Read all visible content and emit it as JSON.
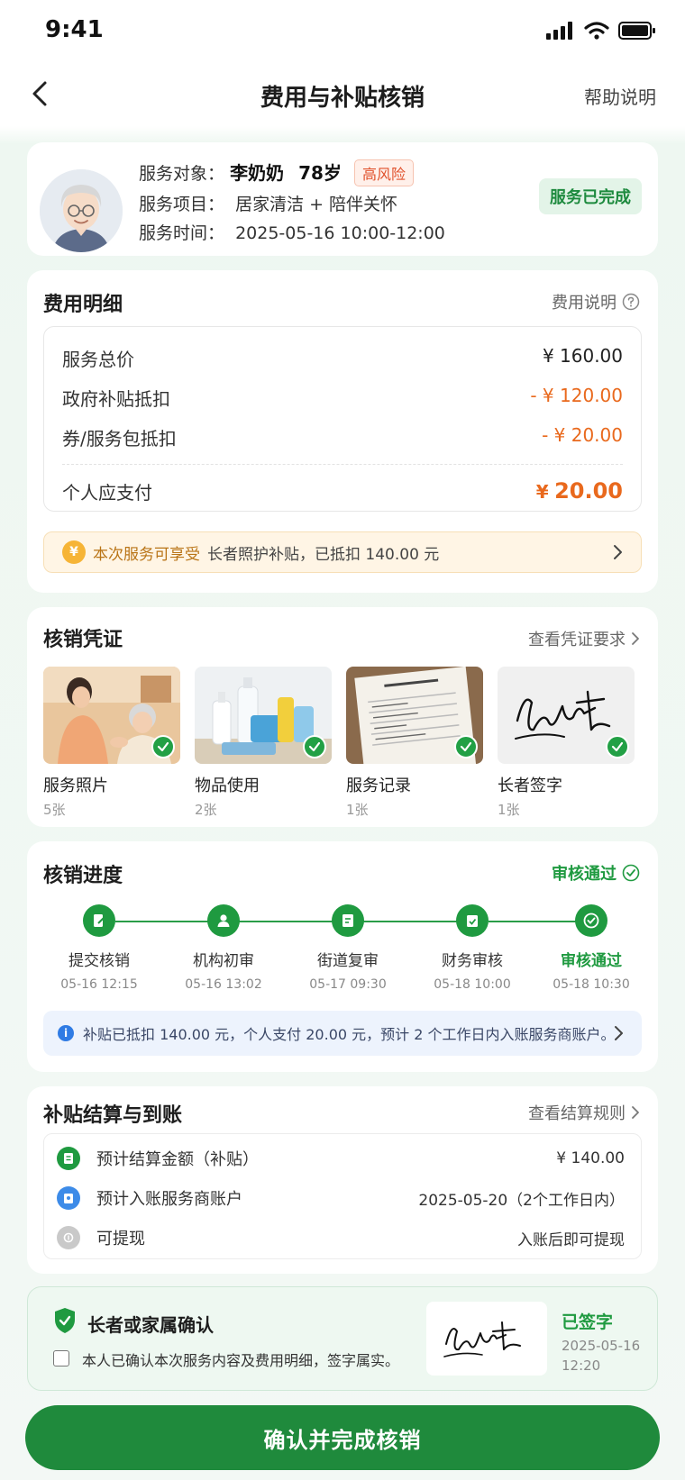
{
  "status_bar": {
    "time": "9:41"
  },
  "nav": {
    "title": "费用与补贴核销",
    "help": "帮助说明"
  },
  "service": {
    "target_label": "服务对象：",
    "name": "李奶奶",
    "age": "78岁",
    "risk": "高风险",
    "item_label": "服务项目：",
    "item": "居家清洁 + 陪伴关怀",
    "time_label": "服务时间：",
    "time": "2025-05-16  10:00-12:00",
    "status": "服务已完成"
  },
  "fees": {
    "title": "费用明细",
    "explain": "费用说明",
    "rows": [
      {
        "label": "服务总价",
        "value": "¥ 160.00"
      },
      {
        "label": "政府补贴抵扣",
        "value": "- ¥ 120.00"
      },
      {
        "label": "券/服务包抵扣",
        "value": "- ¥ 20.00"
      }
    ],
    "total_label": "个人应支付",
    "total_currency": "¥",
    "total_value": "20.00",
    "subsidy_highlight": "本次服务可享受",
    "subsidy_text": "长者照护补贴，已抵扣 140.00 元"
  },
  "proofs": {
    "title": "核销凭证",
    "link": "查看凭证要求",
    "items": [
      {
        "label": "服务照片",
        "count": "5张"
      },
      {
        "label": "物品使用",
        "count": "2张"
      },
      {
        "label": "服务记录",
        "count": "1张"
      },
      {
        "label": "长者签字",
        "count": "1张"
      }
    ]
  },
  "progress": {
    "title": "核销进度",
    "status": "审核通过",
    "steps": [
      {
        "label": "提交核销",
        "time": "05-16 12:15"
      },
      {
        "label": "机构初审",
        "time": "05-16 13:02"
      },
      {
        "label": "街道复审",
        "time": "05-17 09:30"
      },
      {
        "label": "财务审核",
        "time": "05-18 10:00"
      },
      {
        "label": "审核通过",
        "time": "05-18 10:30"
      }
    ],
    "notice": "补贴已抵扣 140.00 元，个人支付 20.00 元，预计 2 个工作日内入账服务商账户。"
  },
  "settlement": {
    "title": "补贴结算与到账",
    "link": "查看结算规则",
    "rows": [
      {
        "label": "预计结算金额（补贴）",
        "value": "¥ 140.00"
      },
      {
        "label": "预计入账服务商账户",
        "value": "2025-05-20（2个工作日内）"
      },
      {
        "label": "可提现",
        "value": "入账后即可提现"
      }
    ]
  },
  "confirm": {
    "title": "长者或家属确认",
    "text": "本人已确认本次服务内容及费用明细，签字属实。",
    "signed": "已签字",
    "date": "2025-05-16",
    "time": "12:20"
  },
  "action": {
    "button": "确认并完成核销"
  },
  "colors": {
    "primary": "#1f8a3c",
    "accent_orange": "#e9691d",
    "info_blue": "#2f7be4"
  }
}
